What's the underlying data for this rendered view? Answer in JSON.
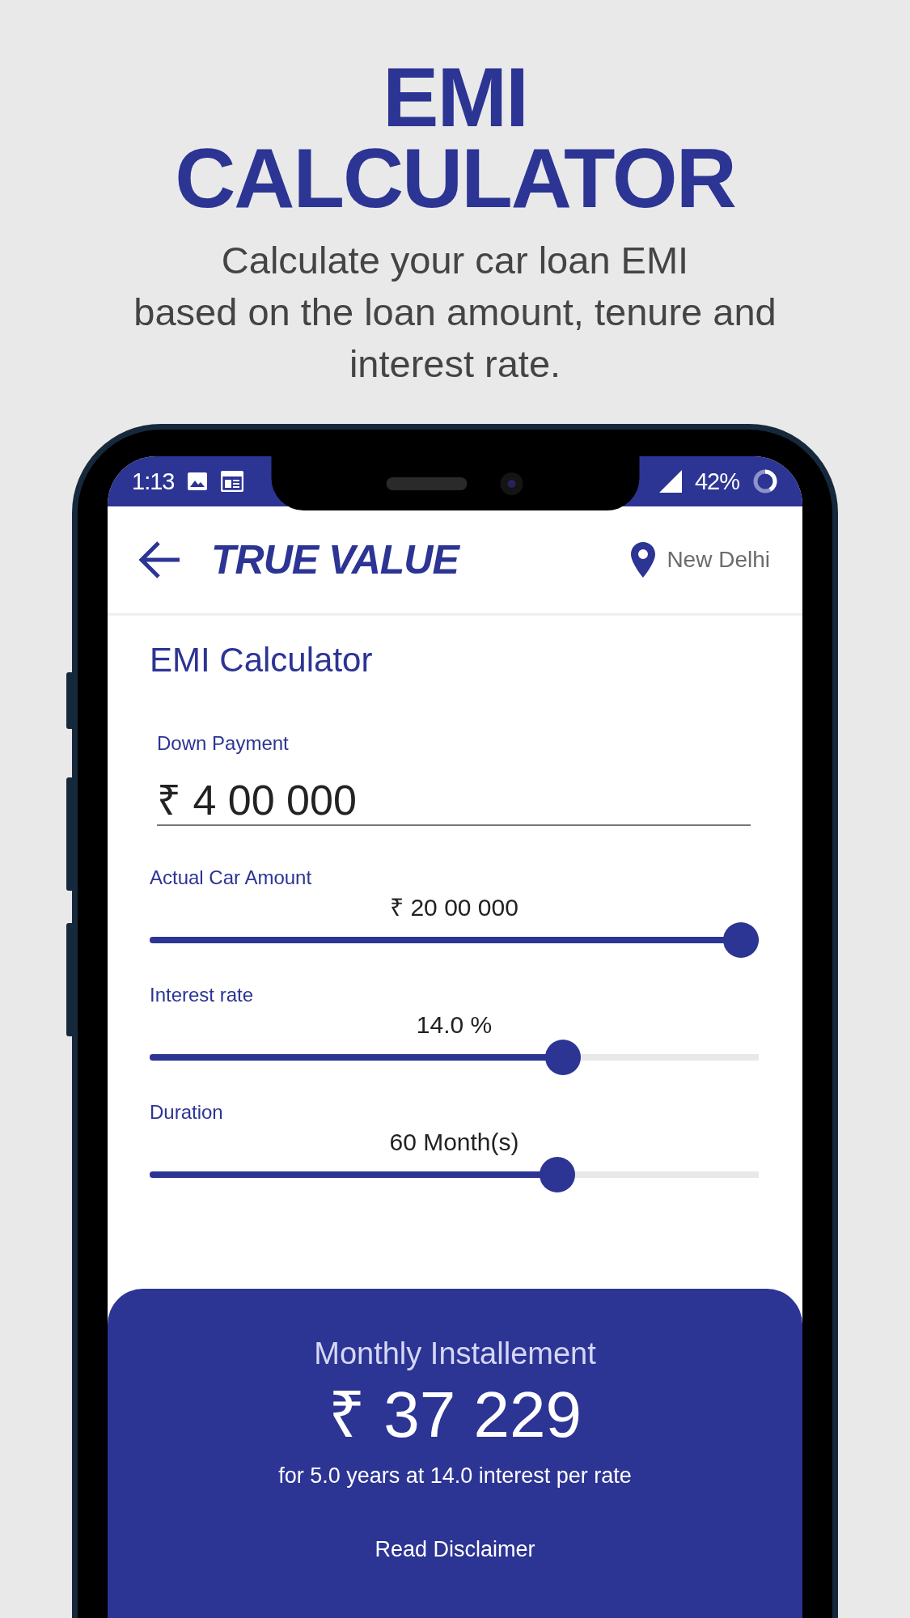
{
  "promo": {
    "title_lines": [
      "EMI",
      "CALCULATOR"
    ],
    "subtitle": "Calculate your car loan EMI\nbased on the loan amount, tenure and interest rate."
  },
  "status_bar": {
    "time": "1:13",
    "battery": "42%"
  },
  "app_header": {
    "logo": "TRUE VALUE",
    "location": "New Delhi"
  },
  "page_title": "EMI Calculator",
  "down_payment": {
    "label": "Down Payment",
    "value": "₹ 4 00 000"
  },
  "sliders": [
    {
      "label": "Actual Car Amount",
      "reading": "₹ 20 00 000",
      "level": 1
    },
    {
      "label": "Interest rate",
      "reading": "14.0 %",
      "level": 0.69
    },
    {
      "label": "Duration",
      "reading": "60 Month(s)",
      "level": 0.68
    }
  ],
  "result": {
    "heading": "Monthly Installement",
    "amount": "₹ 37 229",
    "summary": "for 5.0 years at 14.0 interest per rate",
    "link": "Read Disclaimer"
  }
}
